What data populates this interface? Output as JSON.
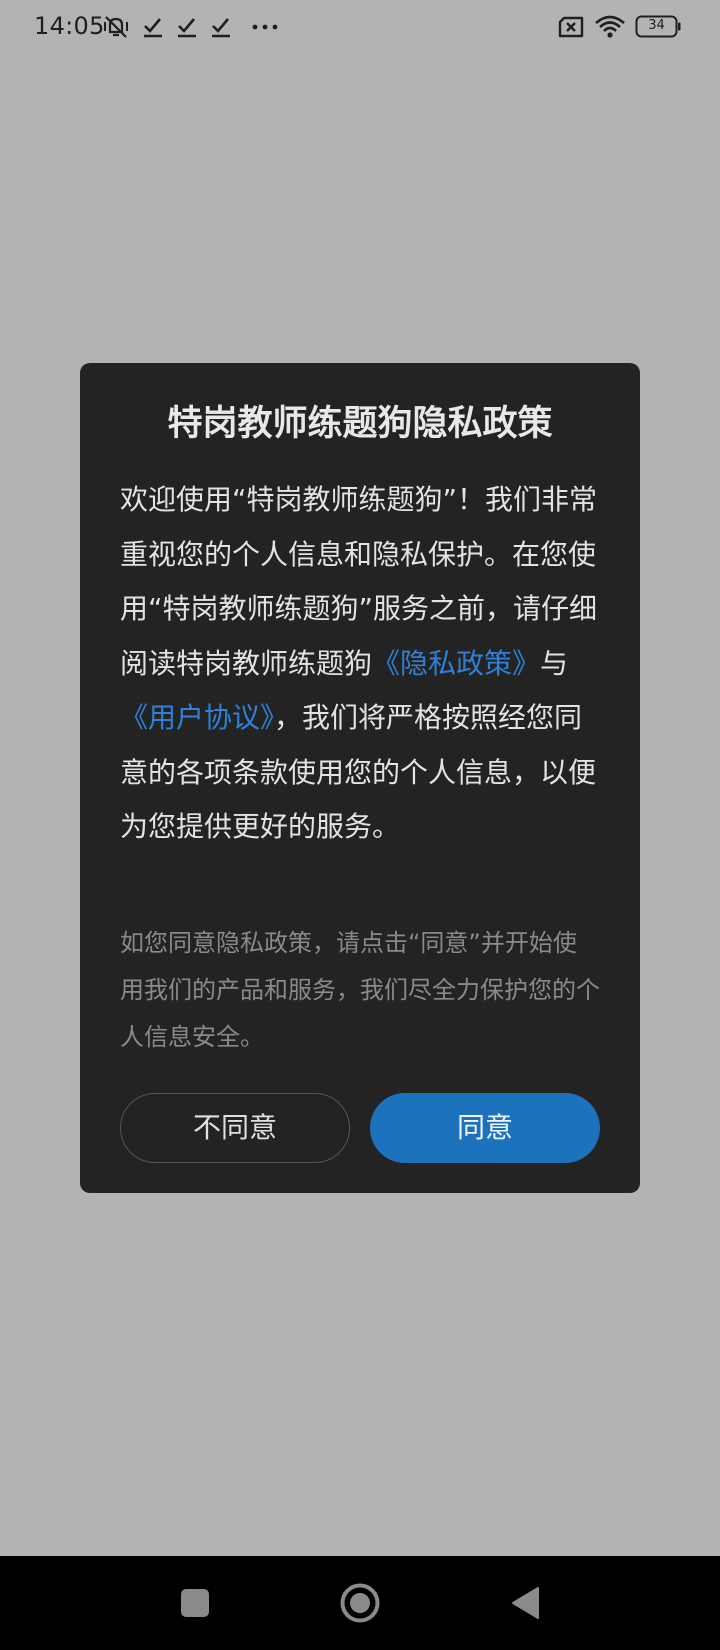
{
  "status_bar": {
    "time": "14:05",
    "icons": [
      "mute-vibrate-icon",
      "check-icon",
      "check-icon",
      "check-icon",
      "more-dots-icon",
      "no-sim-icon",
      "wifi-icon",
      "battery-icon"
    ],
    "battery_level": "34"
  },
  "dialog": {
    "title": "特岗教师练题狗隐私政策",
    "body": {
      "part1": "欢迎使用“特岗教师练题狗”！我们非常重视您的个人信息和隐私保护。在您使用“特岗教师练题狗”服务之前，请仔细阅读特岗教师练题狗",
      "privacy_link": "《隐私政策》",
      "connector": "与",
      "agreement_link": "《用户协议》",
      "part2": "，我们将严格按照经您同意的各项条款使用您的个人信息，以便为您提供更好的服务。"
    },
    "note": "如您同意隐私政策，请点击“同意”并开始使用我们的产品和服务，我们尽全力保护您的个人信息安全。",
    "disagree_label": "不同意",
    "agree_label": "同意"
  },
  "nav_bar": {
    "buttons": [
      "recents-square-icon",
      "home-circle-icon",
      "back-triangle-icon"
    ]
  },
  "colors": {
    "overlay": "#b3b3b3",
    "dialog_bg": "#232323",
    "link": "#2f80d6",
    "agree_button": "#1d72be"
  }
}
